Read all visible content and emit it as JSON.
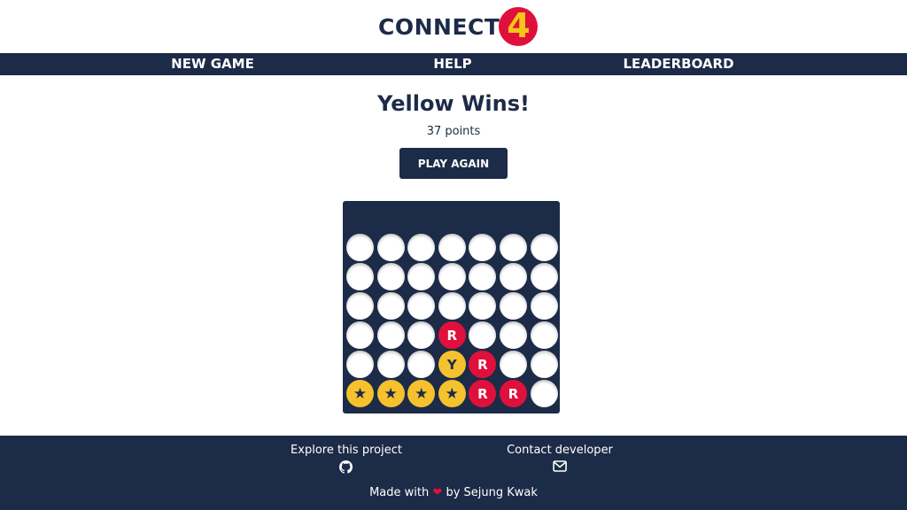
{
  "header": {
    "logo_text": "CONNECT",
    "logo_number": "4"
  },
  "nav": {
    "items": [
      {
        "label": "NEW GAME"
      },
      {
        "label": "HELP"
      },
      {
        "label": "LEADERBOARD"
      }
    ]
  },
  "result": {
    "title": "Yellow Wins!",
    "points": "37 points",
    "play_again_label": "PLAY AGAIN"
  },
  "board": {
    "columns": 7,
    "rows": 6,
    "legend": {
      "R": "red",
      "Y": "yellow",
      "*": "winning yellow (star)",
      ".": "empty"
    },
    "grid": [
      [
        ".",
        ".",
        ".",
        ".",
        ".",
        ".",
        "."
      ],
      [
        ".",
        ".",
        ".",
        ".",
        ".",
        ".",
        "."
      ],
      [
        ".",
        ".",
        ".",
        ".",
        ".",
        ".",
        "."
      ],
      [
        ".",
        ".",
        ".",
        "R",
        ".",
        ".",
        "."
      ],
      [
        ".",
        ".",
        ".",
        "Y",
        "R",
        ".",
        "."
      ],
      [
        "*",
        "*",
        "*",
        "*",
        "R",
        "R",
        "."
      ]
    ],
    "red_label": "R",
    "yellow_label": "Y",
    "star_glyph": "★"
  },
  "footer": {
    "explore_label": "Explore this project",
    "explore_icon": "github-icon",
    "contact_label": "Contact developer",
    "contact_icon": "envelope-icon",
    "made_with_prefix": "Made with",
    "heart_glyph": "❤",
    "made_with_suffix": "by Sejung Kwak"
  },
  "colors": {
    "navy": "#1c2b47",
    "red": "#e0103c",
    "yellow": "#f5c12e",
    "white": "#ffffff"
  }
}
